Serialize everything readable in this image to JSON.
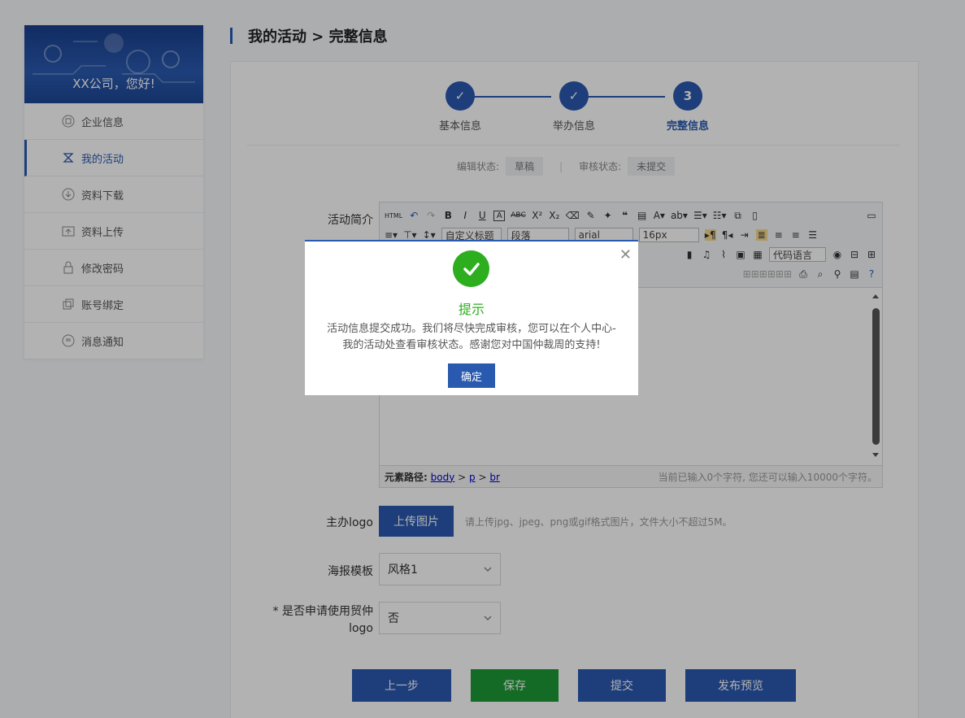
{
  "sidebar": {
    "greeting": "XX公司，您好!",
    "items": [
      {
        "label": "企业信息",
        "icon": "company-icon"
      },
      {
        "label": "我的活动",
        "icon": "activity-icon",
        "active": true
      },
      {
        "label": "资料下载",
        "icon": "download-icon"
      },
      {
        "label": "资料上传",
        "icon": "upload-icon"
      },
      {
        "label": "修改密码",
        "icon": "lock-icon"
      },
      {
        "label": "账号绑定",
        "icon": "link-icon"
      },
      {
        "label": "消息通知",
        "icon": "message-icon"
      }
    ]
  },
  "header": {
    "title": "我的活动 > 完整信息"
  },
  "steps": [
    {
      "mark": "✓",
      "label": "基本信息"
    },
    {
      "mark": "✓",
      "label": "举办信息"
    },
    {
      "mark": "3",
      "label": "完整信息"
    }
  ],
  "status": {
    "edit_label": "编辑状态:",
    "edit_value": "草稿",
    "audit_label": "审核状态:",
    "audit_value": "未提交"
  },
  "form": {
    "intro_label": "活动简介",
    "logo_label": "主办logo",
    "upload_button": "上传图片",
    "upload_hint": "请上传jpg、jpeg、png或gif格式图片，文件大小不超过5M。",
    "poster_label": "海报模板",
    "poster_value": "风格1",
    "trade_label_line1": "* 是否申请使用贸仲",
    "trade_label_line2": "logo",
    "trade_value": "否"
  },
  "editor": {
    "toolbar": {
      "custom_title": "自定义标题",
      "paragraph": "段落",
      "font": "arial",
      "size": "16px",
      "code_lang": "代码语言"
    },
    "path_label": "元素路径:",
    "path": [
      "body",
      "p",
      "br"
    ],
    "counter": "当前已输入0个字符, 您还可以输入10000个字符。"
  },
  "actions": {
    "prev": "上一步",
    "save": "保存",
    "submit": "提交",
    "preview": "发布预览"
  },
  "modal": {
    "title": "提示",
    "message_line1": "活动信息提交成功。我们将尽快完成审核，您可以在个人中心-",
    "message_line2": "我的活动处查看审核状态。感谢您对中国仲裁周的支持!",
    "ok": "确定"
  },
  "colors": {
    "primary": "#2a5ab0",
    "success": "#2cae1f",
    "save_green": "#1e9a35"
  }
}
